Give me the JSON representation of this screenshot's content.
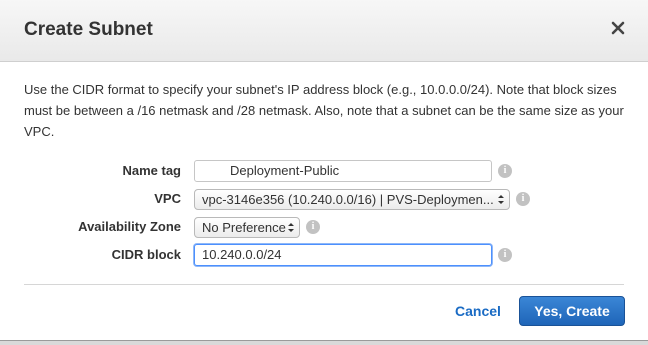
{
  "dialog": {
    "title": "Create Subnet",
    "close_icon": "close-icon",
    "description": "Use the CIDR format to specify your subnet's IP address block (e.g., 10.0.0.0/24). Note that block sizes must be between a /16 netmask and /28 netmask. Also, note that a subnet can be the same size as your VPC."
  },
  "form": {
    "name_tag": {
      "label": "Name tag",
      "value": "Deployment-Public"
    },
    "vpc": {
      "label": "VPC",
      "value": "vpc-3146e356 (10.240.0.0/16) | PVS-Deploymen..."
    },
    "availability_zone": {
      "label": "Availability Zone",
      "value": "No Preference"
    },
    "cidr_block": {
      "label": "CIDR block",
      "value": "10.240.0.0/24"
    },
    "info_icon": "info-icon"
  },
  "footer": {
    "cancel_label": "Cancel",
    "create_label": "Yes, Create"
  },
  "colors": {
    "primary_button": "#1f65b8",
    "link": "#1a6bc4",
    "focus_border": "#4d90fe"
  }
}
